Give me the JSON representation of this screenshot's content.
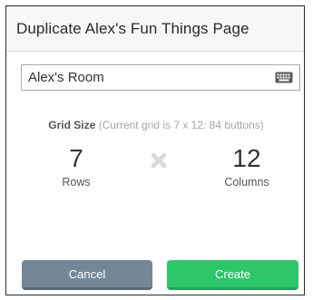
{
  "dialog": {
    "title": "Duplicate Alex's Fun Things Page"
  },
  "name_field": {
    "value": "Alex's Room",
    "keyboard_icon": "keyboard-icon"
  },
  "grid_size": {
    "label": "Grid Size",
    "note": "(Current grid is 7 x 12: 84 buttons)",
    "rows": {
      "value": "7",
      "label": "Rows"
    },
    "columns": {
      "value": "12",
      "label": "Columns"
    },
    "separator_icon": "times-icon"
  },
  "buttons": {
    "cancel": "Cancel",
    "create": "Create"
  },
  "colors": {
    "cancel_bg": "#738797",
    "create_bg": "#2ec66a"
  }
}
